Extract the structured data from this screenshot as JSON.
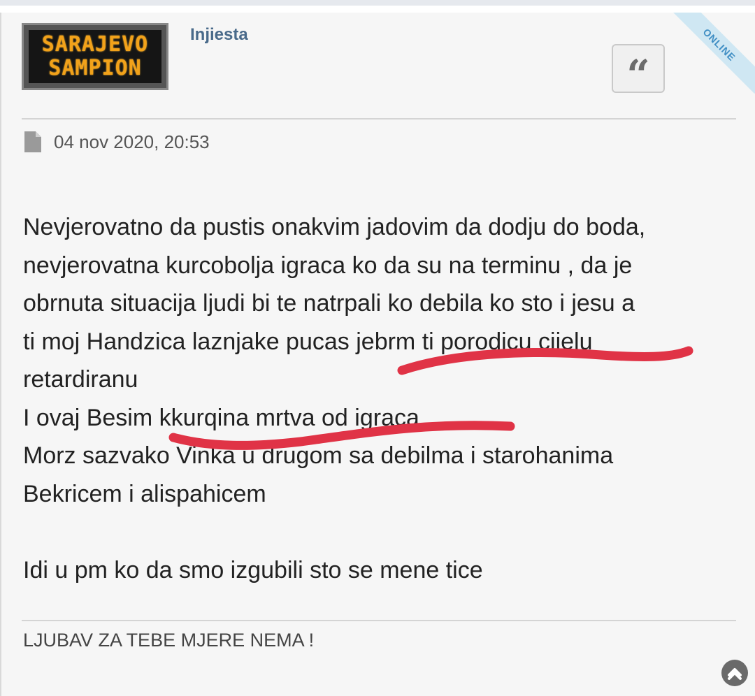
{
  "post": {
    "username": "Injiesta",
    "avatar_text": [
      "SARAJEVO",
      "SAMPION"
    ],
    "status_badge": "ONLINE",
    "quote_icon_glyph": "“",
    "date": "04 nov 2020, 20:53",
    "body_lines": [
      "Nevjerovatno da pustis onakvim jadovim da dodju do boda,",
      "nevjerovatna kurcobolja igraca ko da su na terminu , da je",
      "obrnuta situacija ljudi bi te natrpali ko debila ko sto i jesu a",
      "ti moj Handzica laznjake pucas jebrm ti porodicu cijelu",
      "retardiranu",
      "I ovaj Besim kkurqina mrtva od igraca",
      "Morz sazvako Vinka u drugom sa debilma i starohanima",
      "Bekricem i alispahicem",
      "",
      "Idi u pm ko da smo izgubili sto se mene tice"
    ],
    "signature": "LJUBAV ZA TEBE MJERE NEMA !"
  },
  "icons": {
    "document": "document-icon",
    "quote": "quote-icon",
    "scroll_top": "chevron-up-icon"
  },
  "colors": {
    "username": "#496a8a",
    "led_text": "#f2a21a",
    "online_ribbon": "#cfe7f3",
    "online_text": "#3f8ec4",
    "annotation_marker": "#e03346"
  }
}
